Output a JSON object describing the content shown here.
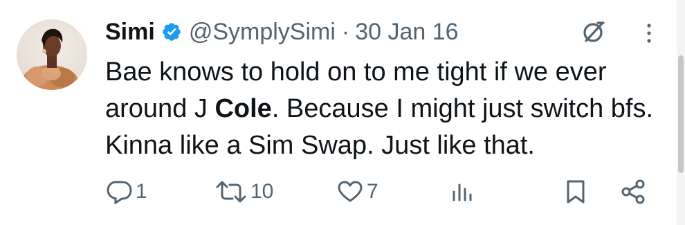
{
  "tweet": {
    "author_name": "Simi",
    "handle": "@SymplySimi",
    "separator": "·",
    "date": "30 Jan 16",
    "text_part1": "Bae knows to hold on to me tight if we ever around J ",
    "text_bold": "Cole",
    "text_part2": ". Because I might just switch bfs. Kinna like a Sim Swap. Just like that.",
    "verified_icon": "verified-badge-icon",
    "colors": {
      "verified": "#1d9bf0",
      "text": "#0f1419",
      "muted": "#536471"
    }
  },
  "actions": {
    "replies": "1",
    "reposts": "10",
    "likes": "7"
  }
}
